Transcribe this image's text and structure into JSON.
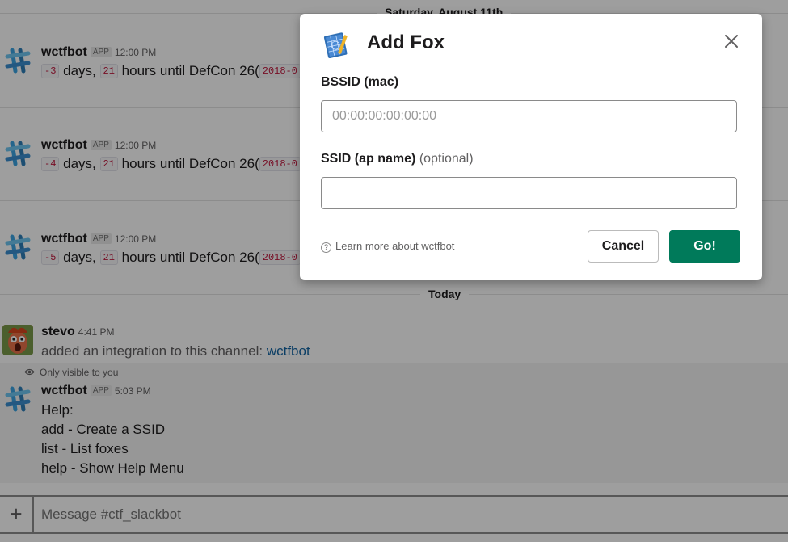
{
  "chat": {
    "day_divider_top": "Saturday, August 11th",
    "day_divider_today": "Today",
    "messages": [
      {
        "author": "wctfbot",
        "badge": "APP",
        "time": "12:00 PM",
        "days": "-3",
        "days_word": "days,",
        "hours": "21",
        "hours_text": "hours until DefCon 26(",
        "date_code": "2018-0"
      },
      {
        "author": "wctfbot",
        "badge": "APP",
        "time": "12:00 PM",
        "days": "-4",
        "days_word": "days,",
        "hours": "21",
        "hours_text": "hours until DefCon 26(",
        "date_code": "2018-0"
      },
      {
        "author": "wctfbot",
        "badge": "APP",
        "time": "12:00 PM",
        "days": "-5",
        "days_word": "days,",
        "hours": "21",
        "hours_text": "hours until DefCon 26(",
        "date_code": "2018-0"
      }
    ],
    "stevo": {
      "author": "stevo",
      "time": "4:41 PM",
      "text": "added an integration to this channel:",
      "link": "wctfbot"
    },
    "ephemeral": {
      "notice": "Only visible to you",
      "author": "wctfbot",
      "badge": "APP",
      "time": "5:03 PM",
      "lines": [
        "Help:",
        "add - Create a SSID",
        "list - List foxes",
        "help - Show Help Menu"
      ]
    },
    "composer": {
      "plus": "+",
      "placeholder": "Message #ctf_slackbot"
    }
  },
  "modal": {
    "title": "Add Fox",
    "bssid_label": "BSSID (mac)",
    "bssid_placeholder": "00:00:00:00:00:00",
    "bssid_value": "",
    "ssid_label": "SSID (ap name)",
    "ssid_optional": "(optional)",
    "ssid_value": "",
    "help_icon": "?",
    "learn_more": "Learn more about wctfbot",
    "cancel_label": "Cancel",
    "submit_label": "Go!"
  },
  "colors": {
    "accent_green": "#007a5a",
    "link_blue": "#1264a3",
    "code_red": "#c0193e"
  },
  "icons": [
    "slack-logo-icon",
    "blueprint-app-icon",
    "close-icon",
    "eye-icon",
    "help-circle-icon",
    "plus-icon"
  ]
}
